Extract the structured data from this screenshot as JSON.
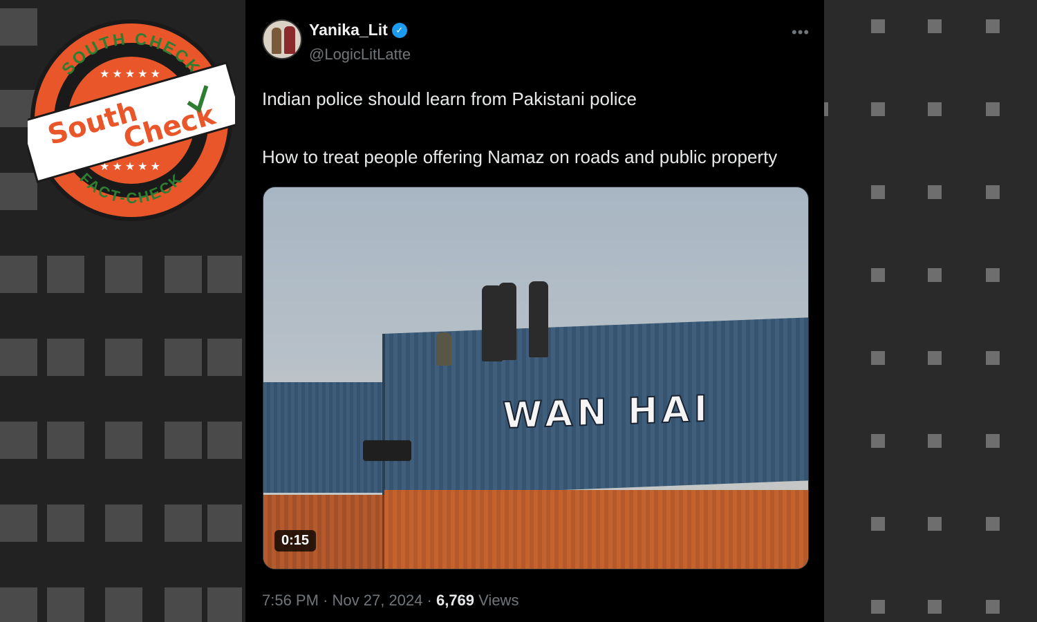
{
  "stamp": {
    "top_text": "SOUTH CHECK",
    "bottom_text": "FACT-CHECK",
    "logo_word_1": "South",
    "logo_word_2": "Check",
    "colors": {
      "ring": "#e8562a",
      "green": "#2e7d32",
      "white": "#ffffff"
    }
  },
  "tweet": {
    "display_name": "Yanika_Lit",
    "verified_icon": "verified-badge-icon",
    "handle": "@LogicLitLatte",
    "more_icon": "more-options-icon",
    "text_line_1": "Indian police should learn from Pakistani police",
    "text_line_2": "How to treat people offering Namaz on roads and public property",
    "media": {
      "container_brand": "WAN HAI",
      "duration": "0:15"
    },
    "time": "7:56 PM",
    "date": "Nov 27, 2024",
    "views_count": "6,769",
    "views_label": "Views"
  },
  "colors": {
    "background": "#000000",
    "text_primary": "#e7e9ea",
    "text_secondary": "#71767b",
    "verified_blue": "#1d9bf0"
  }
}
